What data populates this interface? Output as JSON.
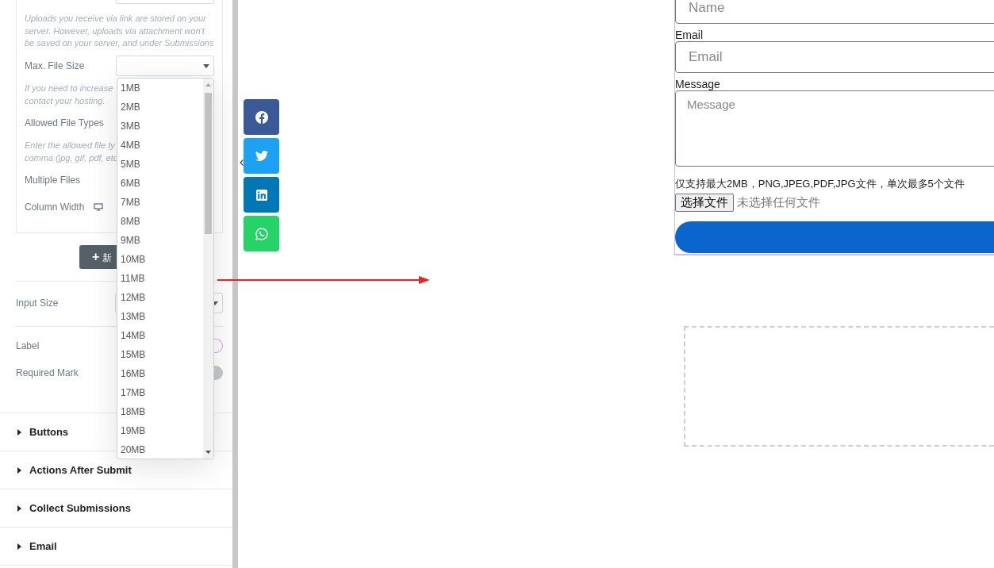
{
  "panel": {
    "upload_note": "Uploads you receive via link are stored on your server. However, uploads via attachment won't be saved on your server, and under Submissions",
    "max_file_size": {
      "label": "Max. File Size",
      "hint_lines": [
        "If you need to increase",
        "contact your hosting."
      ]
    },
    "allowed_file_types": {
      "label": "Allowed File Types",
      "hint_lines": [
        "Enter the allowed file ty",
        "comma (jpg, gif, pdf, etc"
      ]
    },
    "multiple_files": {
      "label": "Multiple Files"
    },
    "column_width": {
      "label": "Column Width"
    },
    "add_button": {
      "icon": "+",
      "label": "新"
    },
    "input_size": {
      "label": "Input Size"
    },
    "label_row": {
      "label": "Label",
      "on": true
    },
    "required_mark": {
      "label": "Required Mark",
      "on": false
    },
    "sections": [
      {
        "title": "Buttons",
        "expanded": false
      },
      {
        "title": "Actions After Submit",
        "expanded": false
      },
      {
        "title": "Collect Submissions",
        "expanded": false
      },
      {
        "title": "Email",
        "expanded": false
      }
    ]
  },
  "dropdown": {
    "options": [
      {
        "label": "1MB",
        "selected": false
      },
      {
        "label": "2MB",
        "selected": false
      },
      {
        "label": "3MB",
        "selected": false
      },
      {
        "label": "4MB",
        "selected": false
      },
      {
        "label": "5MB",
        "selected": false
      },
      {
        "label": "6MB",
        "selected": false
      },
      {
        "label": "7MB",
        "selected": false
      },
      {
        "label": "8MB",
        "selected": false
      },
      {
        "label": "9MB",
        "selected": false
      },
      {
        "label": "10MB",
        "selected": false
      },
      {
        "label": "11MB",
        "selected": false
      },
      {
        "label": "12MB",
        "selected": false
      },
      {
        "label": "13MB",
        "selected": false
      },
      {
        "label": "14MB",
        "selected": false
      },
      {
        "label": "15MB",
        "selected": false
      },
      {
        "label": "16MB",
        "selected": false
      },
      {
        "label": "17MB",
        "selected": false
      },
      {
        "label": "18MB",
        "selected": false
      },
      {
        "label": "19MB",
        "selected": false
      },
      {
        "label": "20MB",
        "selected": false
      }
    ]
  },
  "share_bar": {
    "buttons": [
      {
        "kind": "facebook",
        "color": "#3b5998"
      },
      {
        "kind": "twitter",
        "color": "#1da1f2"
      },
      {
        "kind": "linkedin",
        "color": "#0077b5"
      },
      {
        "kind": "whatsapp",
        "color": "#25d366"
      }
    ]
  },
  "form": {
    "fields": [
      {
        "kind": "input",
        "placeholder": "Name"
      },
      {
        "kind": "input",
        "label": "Email",
        "placeholder": "Email"
      },
      {
        "kind": "textarea",
        "label": "Message",
        "placeholder": "Message"
      }
    ],
    "upload_hint": "仅支持最大2MB，PNG,JPEG,PDF,JPG文件，单次最多5个文件",
    "file_button": "选择文件",
    "file_status": "未选择任何文件"
  }
}
